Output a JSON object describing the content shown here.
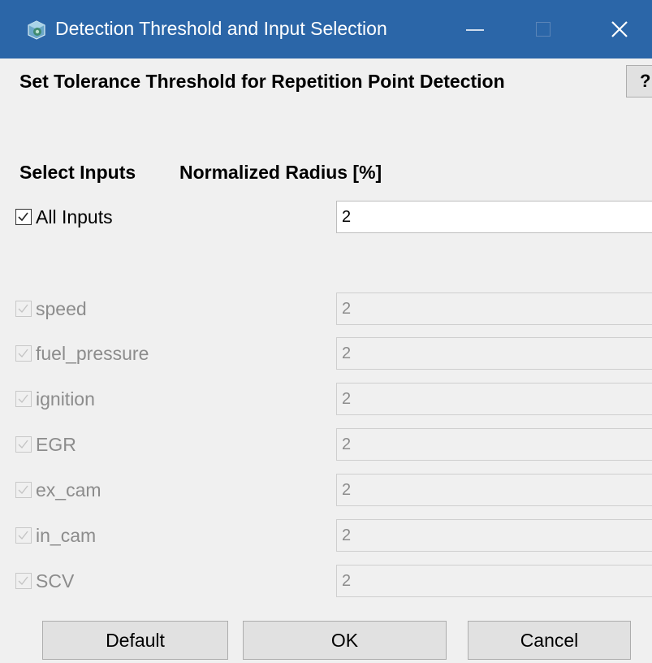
{
  "window": {
    "title": "Detection Threshold and Input Selection",
    "minimize_glyph": "",
    "close_glyph": "✕"
  },
  "heading": "Set Tolerance Threshold for Repetition Point Detection",
  "help_label": "?",
  "columns": {
    "inputs": "Select Inputs",
    "radius": "Normalized Radius [%]"
  },
  "all_inputs": {
    "label": "All Inputs",
    "checked": true,
    "value": "2"
  },
  "inputs": [
    {
      "label": "speed",
      "checked": true,
      "value": "2"
    },
    {
      "label": "fuel_pressure",
      "checked": true,
      "value": "2"
    },
    {
      "label": "ignition",
      "checked": true,
      "value": "2"
    },
    {
      "label": "EGR",
      "checked": true,
      "value": "2"
    },
    {
      "label": "ex_cam",
      "checked": true,
      "value": "2"
    },
    {
      "label": "in_cam",
      "checked": true,
      "value": "2"
    },
    {
      "label": "SCV",
      "checked": true,
      "value": "2"
    }
  ],
  "buttons": {
    "default": "Default",
    "ok": "OK",
    "cancel": "Cancel"
  },
  "colors": {
    "titlebar": "#2b66a8",
    "disabled_text": "#8c8c8c"
  }
}
